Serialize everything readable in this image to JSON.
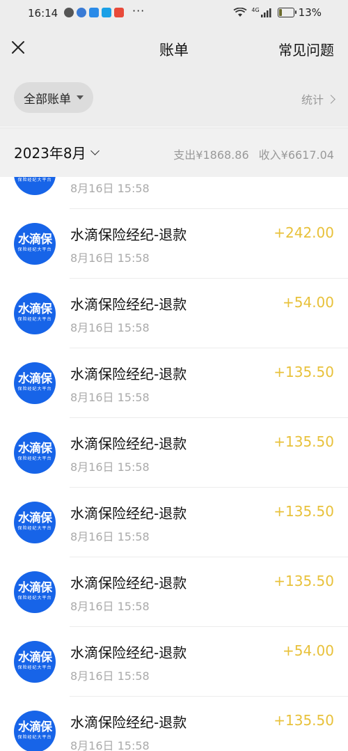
{
  "status_bar": {
    "time": "16:14",
    "more": "···",
    "network": "4G",
    "battery": "13%"
  },
  "header": {
    "title": "账单",
    "faq_label": "常见问题",
    "close_icon": "close-icon"
  },
  "filter": {
    "label": "全部账单",
    "stats_label": "统计"
  },
  "month_bar": {
    "month": "2023年8月",
    "expense": "支出¥1868.86",
    "income": "收入¥6617.04"
  },
  "avatar": {
    "main": "水滴保",
    "sub": "保险经纪大平台"
  },
  "colors": {
    "amount": "#e8c13a",
    "avatar_bg": "#1764e8",
    "header_bg": "#ededed"
  },
  "transactions": [
    {
      "title": "",
      "time": "8月16日 15:58",
      "amount": ""
    },
    {
      "title": "水滴保险经纪-退款",
      "time": "8月16日 15:58",
      "amount": "+242.00"
    },
    {
      "title": "水滴保险经纪-退款",
      "time": "8月16日 15:58",
      "amount": "+54.00"
    },
    {
      "title": "水滴保险经纪-退款",
      "time": "8月16日 15:58",
      "amount": "+135.50"
    },
    {
      "title": "水滴保险经纪-退款",
      "time": "8月16日 15:58",
      "amount": "+135.50"
    },
    {
      "title": "水滴保险经纪-退款",
      "time": "8月16日 15:58",
      "amount": "+135.50"
    },
    {
      "title": "水滴保险经纪-退款",
      "time": "8月16日 15:58",
      "amount": "+135.50"
    },
    {
      "title": "水滴保险经纪-退款",
      "time": "8月16日 15:58",
      "amount": "+54.00"
    },
    {
      "title": "水滴保险经纪-退款",
      "time": "8月16日 15:58",
      "amount": "+135.50"
    }
  ]
}
